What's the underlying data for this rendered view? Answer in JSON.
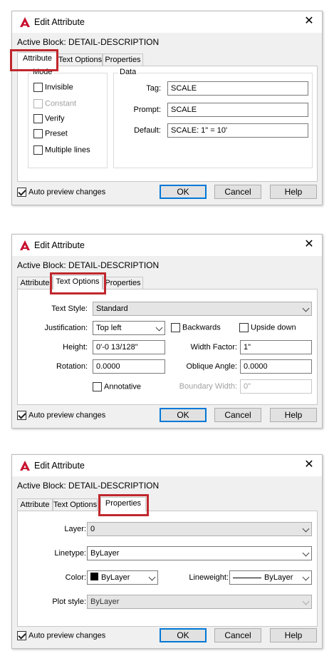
{
  "dialogs": [
    {
      "title": "Edit Attribute",
      "active_block": "Active Block: DETAIL-DESCRIPTION",
      "tabs": [
        "Attribute",
        "Text Options",
        "Properties"
      ],
      "selected_tab": "Attribute",
      "mode": {
        "title": "Mode",
        "options": [
          {
            "label": "Invisible",
            "checked": false,
            "enabled": true
          },
          {
            "label": "Constant",
            "checked": false,
            "enabled": false
          },
          {
            "label": "Verify",
            "checked": false,
            "enabled": true
          },
          {
            "label": "Preset",
            "checked": false,
            "enabled": true
          },
          {
            "label": "Multiple lines",
            "checked": false,
            "enabled": true
          }
        ]
      },
      "data": {
        "title": "Data",
        "tag_label": "Tag:",
        "tag_value": "SCALE",
        "prompt_label": "Prompt:",
        "prompt_value": "SCALE",
        "default_label": "Default:",
        "default_value": "SCALE: 1\" = 10'"
      },
      "footer": {
        "auto_preview": "Auto preview changes",
        "auto_preview_checked": true,
        "ok": "OK",
        "cancel": "Cancel",
        "help": "Help"
      }
    },
    {
      "title": "Edit Attribute",
      "active_block": "Active Block: DETAIL-DESCRIPTION",
      "tabs": [
        "Attribute",
        "Text Options",
        "Properties"
      ],
      "selected_tab": "Text Options",
      "text_options": {
        "text_style_label": "Text Style:",
        "text_style_value": "Standard",
        "justification_label": "Justification:",
        "justification_value": "Top left",
        "backwards_label": "Backwards",
        "backwards_checked": false,
        "upside_down_label": "Upside down",
        "upside_down_checked": false,
        "height_label": "Height:",
        "height_value": "0'-0 13/128\"",
        "width_factor_label": "Width Factor:",
        "width_factor_value": "1\"",
        "rotation_label": "Rotation:",
        "rotation_value": "0.0000",
        "oblique_label": "Oblique Angle:",
        "oblique_value": "0.0000",
        "annotative_label": "Annotative",
        "annotative_checked": false,
        "boundary_label": "Boundary Width:",
        "boundary_value": "0\""
      },
      "footer": {
        "auto_preview": "Auto preview changes",
        "auto_preview_checked": true,
        "ok": "OK",
        "cancel": "Cancel",
        "help": "Help"
      }
    },
    {
      "title": "Edit Attribute",
      "active_block": "Active Block: DETAIL-DESCRIPTION",
      "tabs": [
        "Attribute",
        "Text Options",
        "Properties"
      ],
      "selected_tab": "Properties",
      "properties": {
        "layer_label": "Layer:",
        "layer_value": "0",
        "linetype_label": "Linetype:",
        "linetype_value": "ByLayer",
        "color_label": "Color:",
        "color_value": "ByLayer",
        "lineweight_label": "Lineweight:",
        "lineweight_value": "ByLayer",
        "plot_style_label": "Plot style:",
        "plot_style_value": "ByLayer"
      },
      "footer": {
        "auto_preview": "Auto preview changes",
        "auto_preview_checked": true,
        "ok": "OK",
        "cancel": "Cancel",
        "help": "Help"
      }
    }
  ],
  "colors": {
    "highlight": "#c0282e",
    "app_icon": "#c8102e",
    "default_button_border": "#0078d7"
  },
  "icons": {
    "app": "autocad-logo-icon",
    "close": "close-icon",
    "dropdown": "chevron-down-icon",
    "checkbox": "checkbox-icon"
  }
}
